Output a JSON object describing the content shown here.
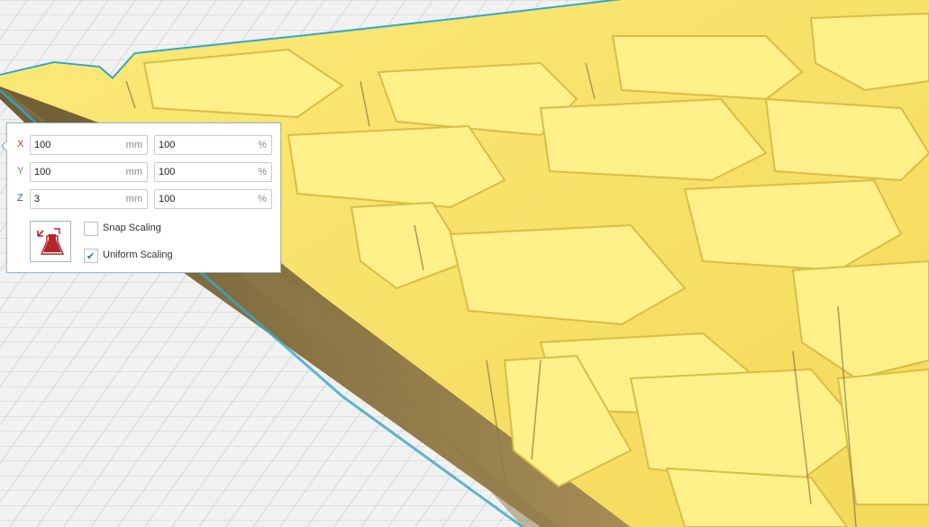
{
  "scale_panel": {
    "x": {
      "axis": "X",
      "value": "100",
      "unit": "mm",
      "percent": "100",
      "percent_unit": "%"
    },
    "y": {
      "axis": "Y",
      "value": "100",
      "unit": "mm",
      "percent": "100",
      "percent_unit": "%"
    },
    "z": {
      "axis": "Z",
      "value": "3",
      "unit": "mm",
      "percent": "100",
      "percent_unit": "%"
    },
    "snap_scaling": {
      "label": "Snap Scaling",
      "checked": false
    },
    "uniform_scaling": {
      "label": "Uniform Scaling",
      "checked": true
    },
    "reset_icon": "scale-reset-icon"
  },
  "colors": {
    "axis_x": "#d0312d",
    "axis_y": "#3fa43f",
    "axis_z": "#3050b8",
    "model_top": "#f9e46e",
    "model_side": "#9a8350",
    "build_plate_outline": "#35a8c8",
    "grid_line": "#c9c9c9"
  }
}
